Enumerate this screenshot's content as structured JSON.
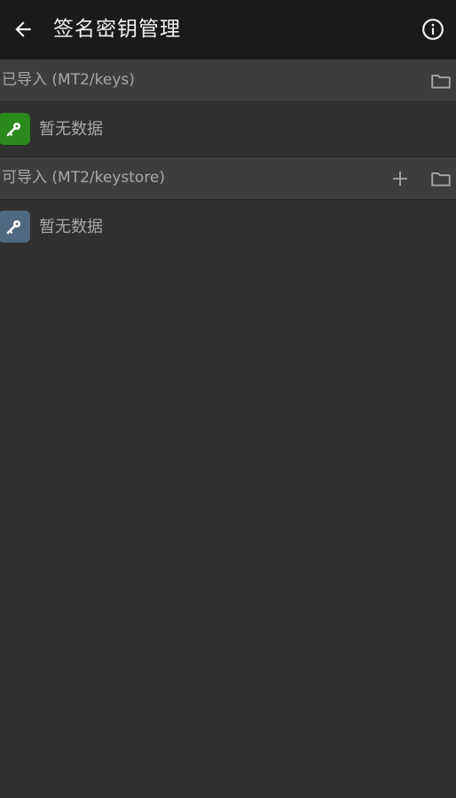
{
  "toolbar": {
    "title": "签名密钥管理",
    "back_icon": "arrow-left-icon",
    "info_icon": "info-icon",
    "background": "#1a1a1a"
  },
  "sections": [
    {
      "title": "已导入 (MT2/keys)",
      "actions": [
        "folder-icon"
      ],
      "empty_text": "暂无数据",
      "badge_color": "#2a8a1c",
      "badge_icon": "key-icon"
    },
    {
      "title": "可导入 (MT2/keystore)",
      "actions": [
        "plus-icon",
        "folder-icon"
      ],
      "empty_text": "暂无数据",
      "badge_color": "#4f6a80",
      "badge_icon": "key-icon"
    }
  ],
  "colors": {
    "background": "#303030",
    "section_header": "#3d3d3d",
    "text": "#a8a8a8"
  }
}
